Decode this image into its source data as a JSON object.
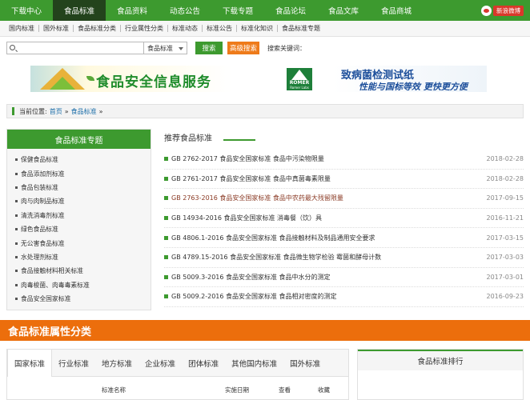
{
  "topnav": {
    "items": [
      "下载中心",
      "食品标准",
      "食品资料",
      "动态公告",
      "下载专题",
      "食品论坛",
      "食品文库",
      "食品商城"
    ],
    "weibo_label": "新浪微博"
  },
  "subnav": {
    "items": [
      "国内标准",
      "国外标准",
      "食品标准分类",
      "行业属性分类",
      "标准动态",
      "标准公告",
      "标准化知识",
      "食品标准专题"
    ]
  },
  "search": {
    "value": "",
    "select_value": "食品标准",
    "search_button": "搜索",
    "advanced_button": "高级搜索",
    "keywords_label": "搜索关键词："
  },
  "banners": {
    "food_safety_text": "食品安全信息服务",
    "romer_logo": "ROMER",
    "romer_sub": "Romer Labs",
    "romer_line1": "致病菌检测试纸",
    "romer_line2": "性能与国标等效 更快更方便"
  },
  "breadcrumb": {
    "label": "当前位置:",
    "home": "首页",
    "sep": "»",
    "current": "食品标准",
    "end": "»"
  },
  "sidebar": {
    "title": "食品标准专题",
    "items": [
      "保健食品标准",
      "食品添加剂标准",
      "食品包装标准",
      "肉与肉制品标准",
      "清洗消毒剂标准",
      "绿色食品标准",
      "无公害食品标准",
      "水处理剂标准",
      "食品接触材料相关标准",
      "肉毒梭菌、肉毒毒素标准",
      "食品安全国家标准"
    ]
  },
  "recommended": {
    "title": "推荐食品标准",
    "rows": [
      {
        "title": "GB 2762-2017 食品安全国家标准 食品中污染物限量",
        "date": "2018-02-28"
      },
      {
        "title": "GB 2761-2017 食品安全国家标准 食品中真菌毒素限量",
        "date": "2018-02-28"
      },
      {
        "title": "GB 2763-2016 食品安全国家标准 食品中农药最大残留限量",
        "date": "2017-09-15"
      },
      {
        "title": "GB 14934-2016 食品安全国家标准 消毒餐（饮）具",
        "date": "2016-11-21"
      },
      {
        "title": "GB 4806.1-2016 食品安全国家标准 食品接触材料及制品通用安全要求",
        "date": "2017-03-15"
      },
      {
        "title": "GB 4789.15-2016 食品安全国家标准 食品微生物学检验 霉菌和酵母计数",
        "date": "2017-03-03"
      },
      {
        "title": "GB 5009.3-2016 食品安全国家标准 食品中水分的测定",
        "date": "2017-03-01"
      },
      {
        "title": "GB 5009.2-2016 食品安全国家标准 食品相对密度的测定",
        "date": "2016-09-23"
      }
    ]
  },
  "section": {
    "title": "食品标准属性分类"
  },
  "tabs": {
    "items": [
      "国家标准",
      "行业标准",
      "地方标准",
      "企业标准",
      "团体标准",
      "其他国内标准",
      "国外标准"
    ],
    "columns": [
      "标准名称",
      "实施日期",
      "查看",
      "收藏"
    ]
  },
  "rank": {
    "title": "食品标准排行"
  },
  "colors": {
    "brand_green": "#3d9a2f",
    "active_nav": "#23431c",
    "orange": "#ec6e0c",
    "highlight_text": "#8a3a24"
  }
}
